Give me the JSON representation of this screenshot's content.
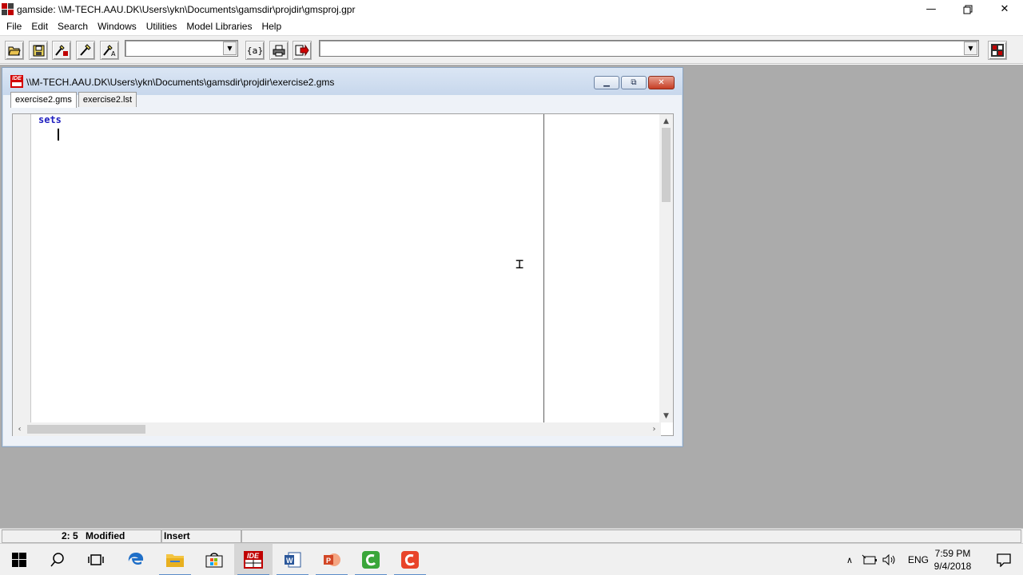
{
  "app": {
    "title": "gamside: \\\\M-TECH.AAU.DK\\Users\\ykn\\Documents\\gamsdir\\projdir\\gmsproj.gpr"
  },
  "menu": [
    "File",
    "Edit",
    "Search",
    "Windows",
    "Utilities",
    "Model Libraries",
    "Help"
  ],
  "toolbar": {
    "combo1_value": "",
    "combo2_value": "",
    "buttons": [
      "open-icon",
      "save-icon",
      "run-icon",
      "wand-icon",
      "wand-options-icon",
      "set-symbol-icon",
      "print-icon",
      "run-arrow-icon",
      "model-library-icon"
    ],
    "set_symbol_glyph": "{a}"
  },
  "child_window": {
    "title": "\\\\M-TECH.AAU.DK\\Users\\ykn\\Documents\\gamsdir\\projdir\\exercise2.gms",
    "tabs": [
      {
        "label": "exercise2.gms",
        "active": true
      },
      {
        "label": "exercise2.lst",
        "active": false
      }
    ]
  },
  "editor": {
    "lines": [
      "sets",
      ""
    ]
  },
  "status": {
    "position": "2: 5",
    "modified": "Modified",
    "mode": "Insert"
  },
  "taskbar": {
    "apps": [
      "start-icon",
      "search-icon",
      "task-view-icon",
      "edge-icon",
      "file-explorer-icon",
      "store-icon",
      "gams-ide-icon",
      "word-icon",
      "powerpoint-icon",
      "camtasia-green-icon",
      "camtasia-red-icon"
    ],
    "language": "ENG",
    "time": "7:59 PM",
    "date": "9/4/2018"
  },
  "colors": {
    "keyword": "#2020c0",
    "workspace": "#ababab",
    "accent": "#5a8cc8"
  }
}
